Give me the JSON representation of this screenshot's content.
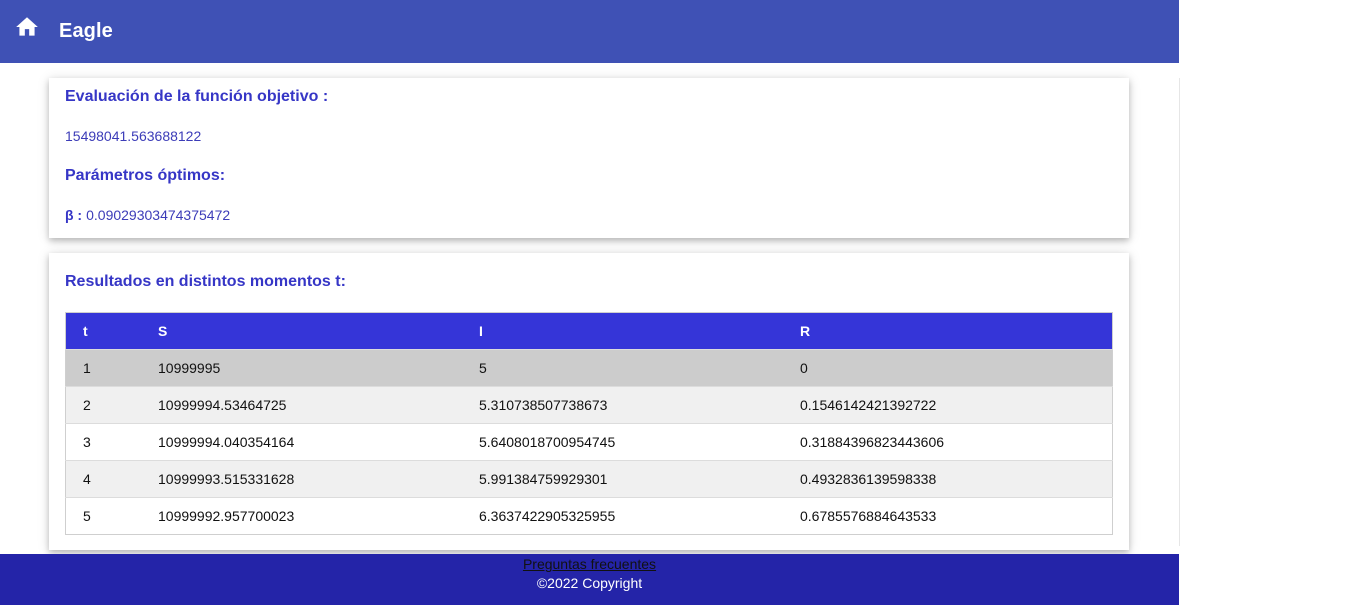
{
  "appbar": {
    "title": "Eagle",
    "home_icon": "home-icon"
  },
  "objective": {
    "heading": "Evaluación de la función objetivo :",
    "value": "15498041.563688122"
  },
  "params": {
    "heading": "Parámetros óptimos:",
    "beta_label": "β :",
    "beta_value": "0.09029303474375472"
  },
  "results": {
    "heading": "Resultados en distintos momentos t:",
    "columns": [
      "t",
      "S",
      "I",
      "R"
    ],
    "rows": [
      [
        "1",
        "10999995",
        "5",
        "0"
      ],
      [
        "2",
        "10999994.53464725",
        "5.310738507738673",
        "0.1546142421392722"
      ],
      [
        "3",
        "10999994.040354164",
        "5.6408018700954745",
        "0.31884396823443606"
      ],
      [
        "4",
        "10999993.515331628",
        "5.991384759929301",
        "0.4932836139598338"
      ],
      [
        "5",
        "10999992.957700023",
        "6.3637422905325955",
        "0.6785576884643533"
      ]
    ]
  },
  "footer": {
    "faq_link": "Preguntas frecuentes",
    "copyright": "©2022 Copyright"
  },
  "colors": {
    "appbar": "#3f51b5",
    "accent_text": "#3636c6",
    "table_header": "#3535d8",
    "footer": "#2424a8"
  }
}
